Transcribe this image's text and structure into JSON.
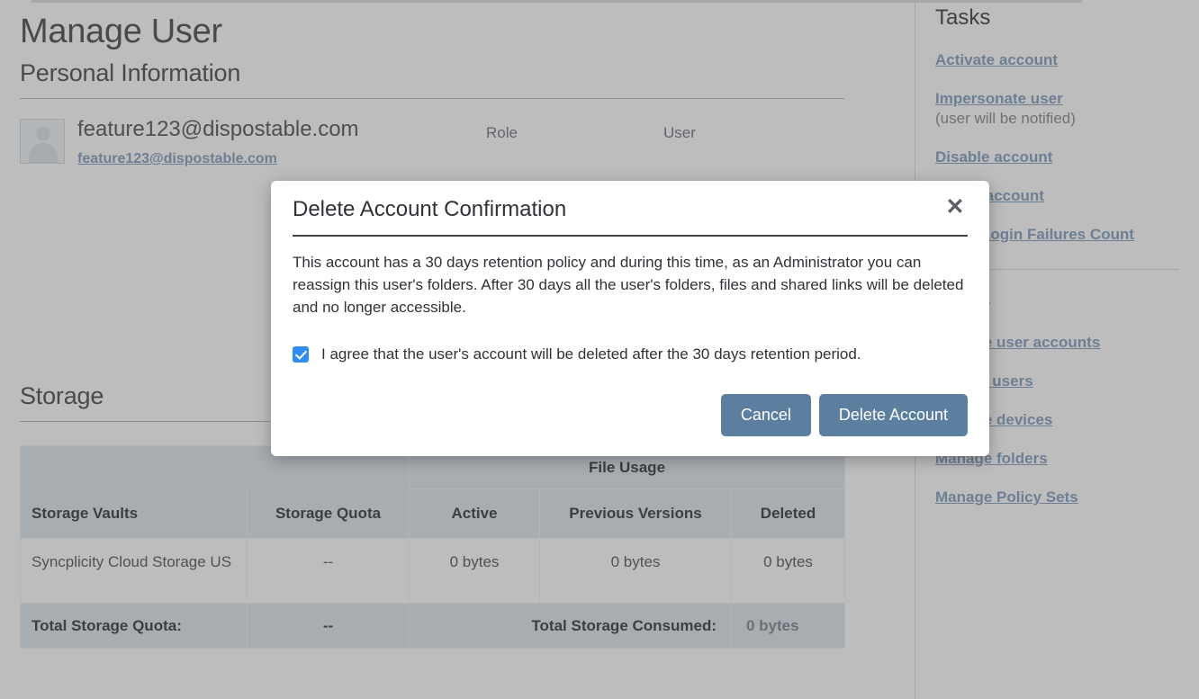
{
  "page": {
    "title": "Manage User",
    "personal_info_heading": "Personal Information",
    "storage_heading": "Storage"
  },
  "user": {
    "display_name": "feature123@dispostable.com",
    "email_link": "feature123@dispostable.com",
    "role_label": "Role",
    "role_value": "User"
  },
  "storage_table": {
    "group_header": "File Usage",
    "columns": [
      "Storage Vaults",
      "Storage Quota",
      "Active",
      "Previous Versions",
      "Deleted"
    ],
    "rows": [
      {
        "vault": "Syncplicity Cloud Storage US",
        "quota": "--",
        "active": "0 bytes",
        "previous_versions": "0 bytes",
        "deleted": "0 bytes"
      }
    ],
    "footer": {
      "quota_label": "Total Storage Quota:",
      "quota_value": "--",
      "consumed_label": "Total Storage Consumed:",
      "consumed_value": "0 bytes"
    }
  },
  "sidebar": {
    "tasks_heading": "Tasks",
    "tasks": [
      {
        "label": "Activate account"
      },
      {
        "label": "Impersonate user",
        "note": "(user will be notified)"
      },
      {
        "label": "Disable account"
      },
      {
        "label": "Delete account"
      },
      {
        "label": "Reset Login Failures Count"
      }
    ],
    "global_tasks_heading": "Tasks",
    "global_tasks": [
      {
        "label": "Manage user accounts"
      },
      {
        "label": "Review users"
      },
      {
        "label": "Manage devices"
      },
      {
        "label": "Manage folders"
      },
      {
        "label": "Manage Policy Sets"
      }
    ]
  },
  "modal": {
    "title": "Delete Account Confirmation",
    "close_icon": "close-icon",
    "body": "This account has a 30 days retention policy and during this time, as an Administrator you can reassign this user's folders. After 30 days all the user's folders, files and shared links will be deleted and no longer accessible.",
    "agree_label": "I agree that the user's account will be deleted after the 30 days retention period.",
    "agree_checked": true,
    "cancel_label": "Cancel",
    "confirm_label": "Delete Account"
  },
  "colors": {
    "page_background": "#bdbdbd",
    "button_blue": "#5c7f9f",
    "link_blue_grey": "#6e7f93",
    "checkbox_blue": "#2f8bf5",
    "table_header": "#a8adb2"
  }
}
